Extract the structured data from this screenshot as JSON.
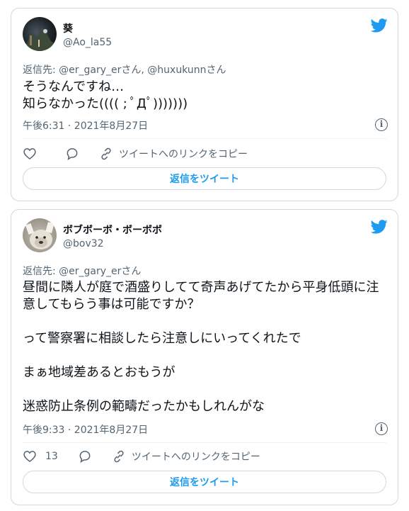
{
  "tweets": [
    {
      "name": "葵",
      "handle": "@Ao_la55",
      "reply_to": "返信先: @er_gary_erさん, @huxukunnさん",
      "text": "そうなんですね…\n知らなかった(((( ; ﾟДﾟ)))))))",
      "time": "午後6:31 · 2021年8月27日",
      "like_count": "",
      "copy_link": "ツイートへのリンクをコピー",
      "reply_button": "返信をツイート"
    },
    {
      "name": "ボブボーボ・ボーボボ",
      "handle": "@bov32",
      "reply_to": "返信先: @er_gary_erさん",
      "text": "昼間に隣人が庭で酒盛りしてて奇声あげてたから平身低頭に注意してもらう事は可能ですか？\n\nって警察署に相談したら注意しにいってくれたで\n\nまぁ地域差あるとおもうが\n\n迷惑防止条例の範疇だったかもしれんがな",
      "time": "午後9:33 · 2021年8月27日",
      "like_count": "13",
      "copy_link": "ツイートへのリンクをコピー",
      "reply_button": "返信をツイート"
    }
  ],
  "colors": {
    "accent": "#1d9bf0",
    "secondary_text": "#536471",
    "border": "#cfd9de"
  },
  "icons": [
    "twitter-bird-icon",
    "like-heart-icon",
    "reply-bubble-icon",
    "link-icon",
    "info-icon"
  ]
}
